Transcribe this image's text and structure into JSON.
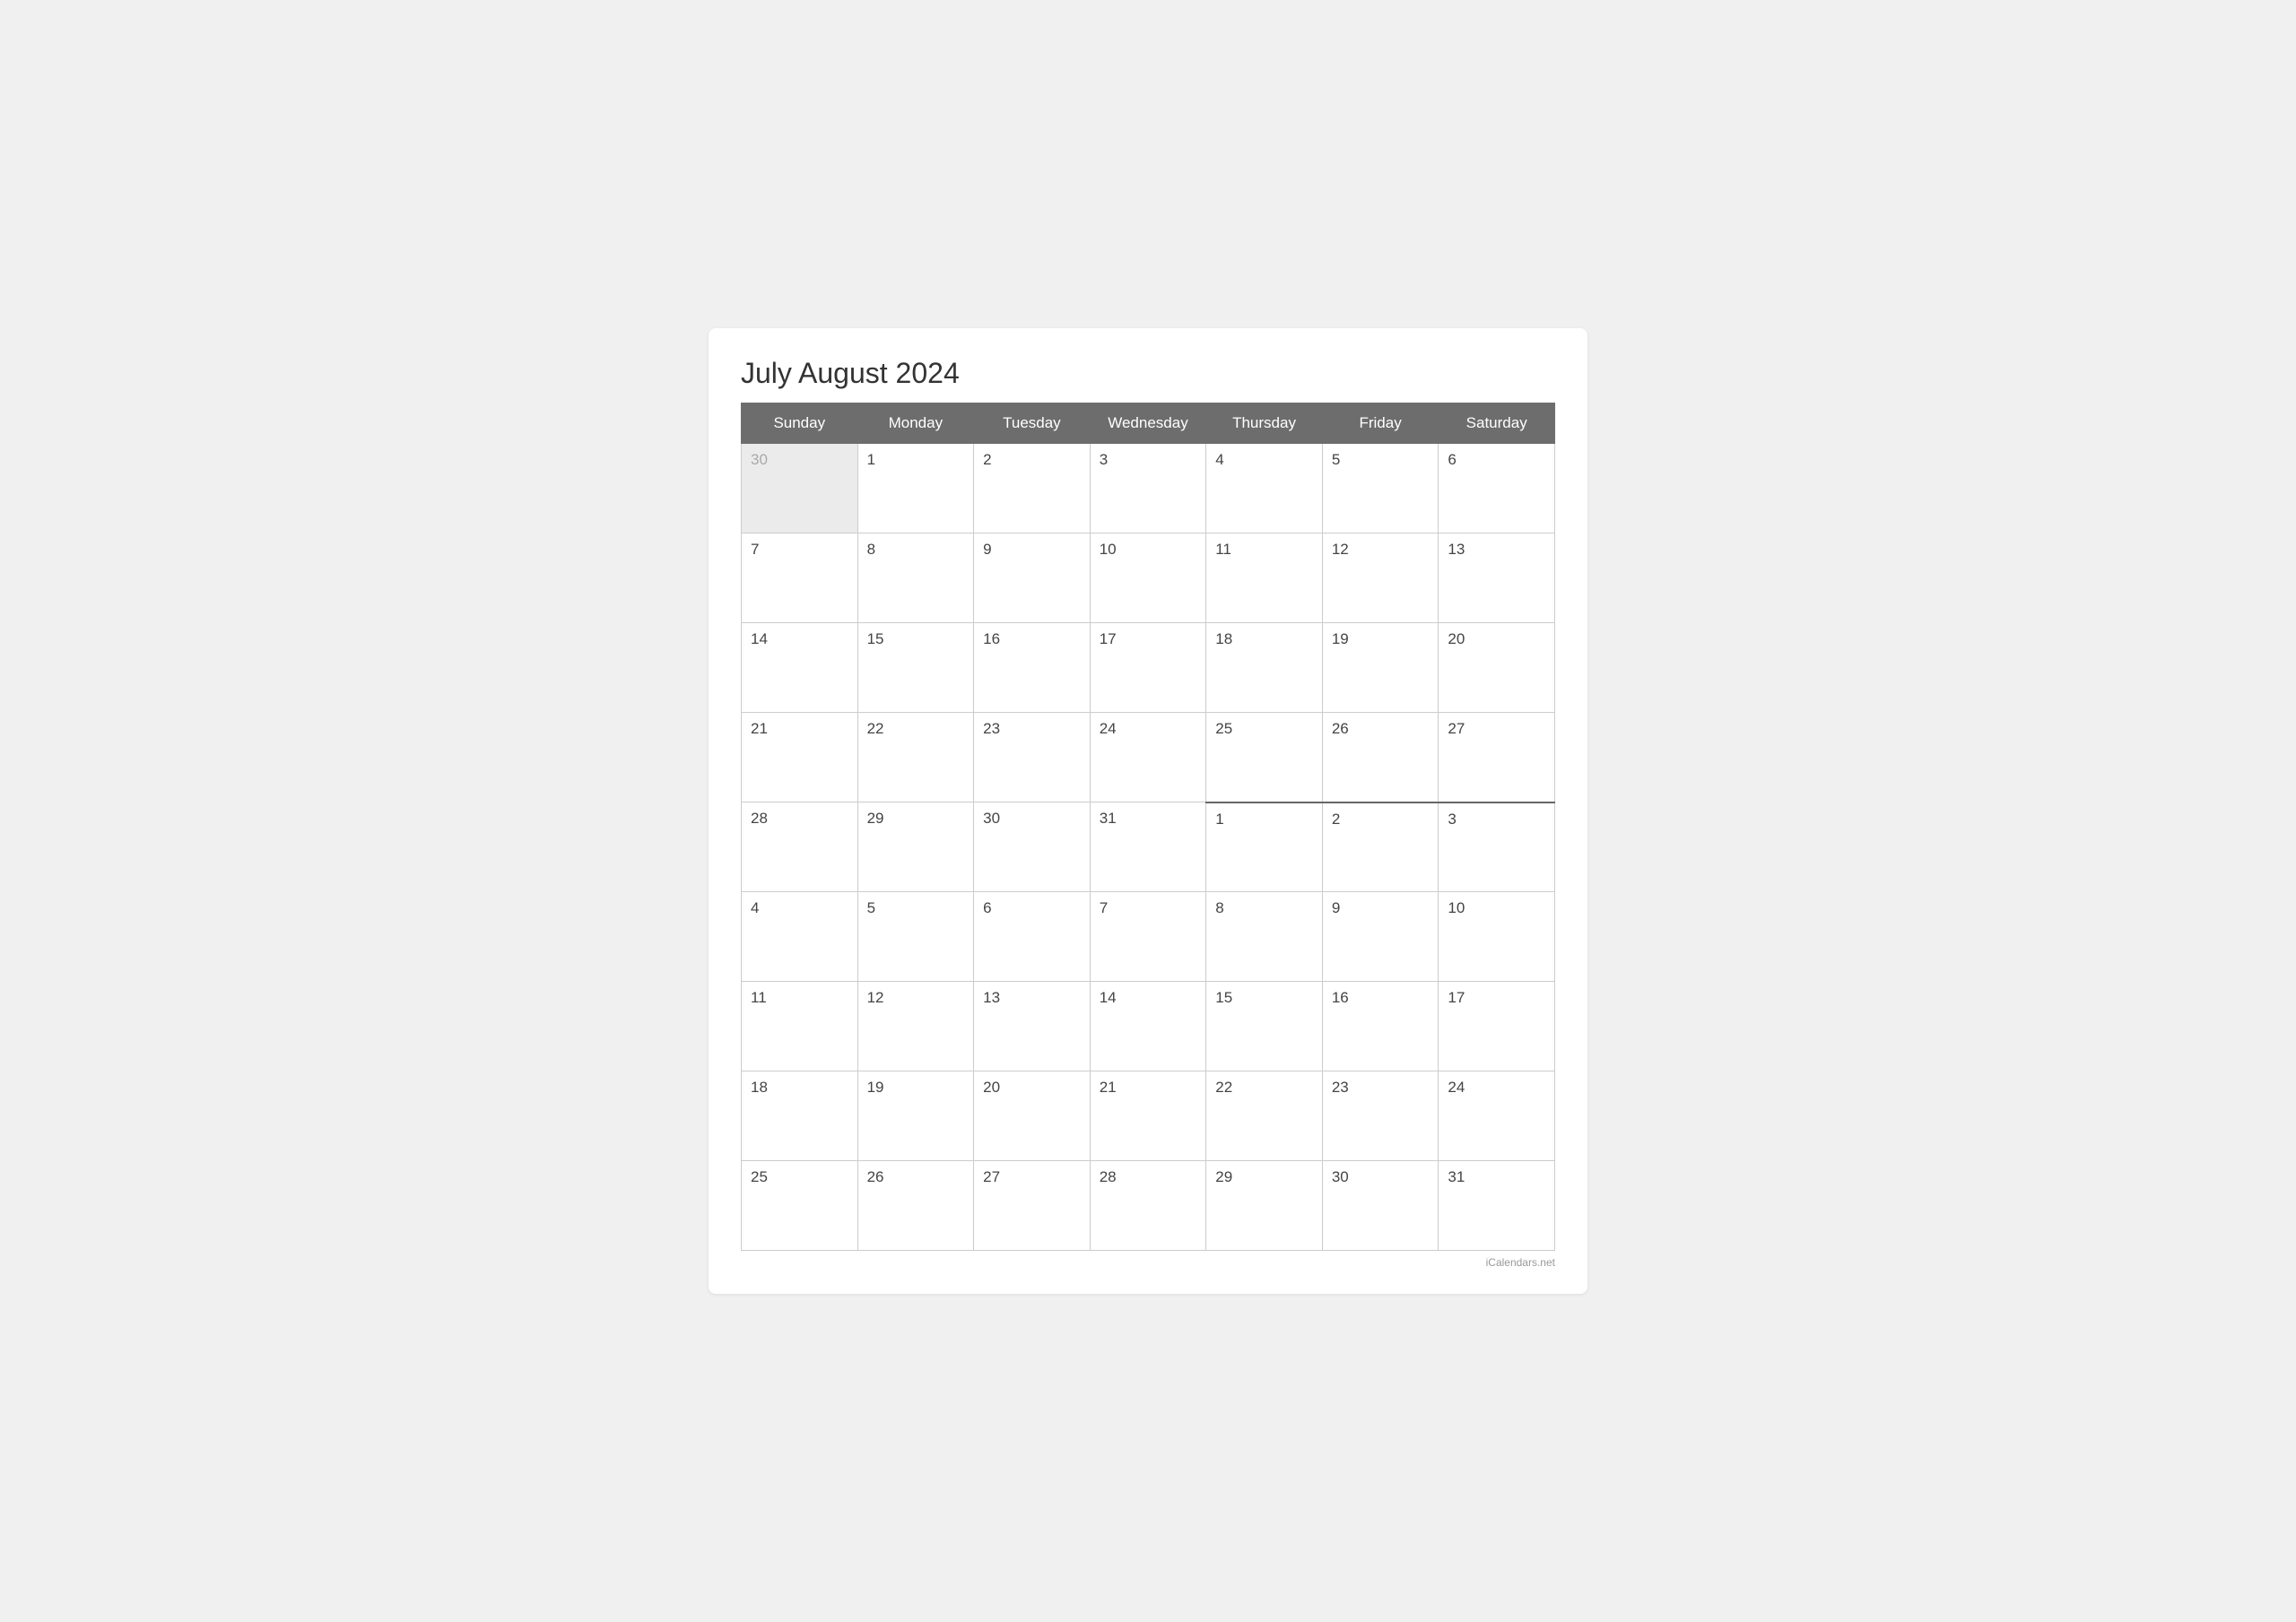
{
  "title": "July August 2024",
  "days_of_week": [
    "Sunday",
    "Monday",
    "Tuesday",
    "Wednesday",
    "Thursday",
    "Friday",
    "Saturday"
  ],
  "weeks": [
    [
      {
        "day": "30",
        "prev_month": true
      },
      {
        "day": "1"
      },
      {
        "day": "2"
      },
      {
        "day": "3"
      },
      {
        "day": "4"
      },
      {
        "day": "5"
      },
      {
        "day": "6"
      }
    ],
    [
      {
        "day": "7"
      },
      {
        "day": "8"
      },
      {
        "day": "9"
      },
      {
        "day": "10"
      },
      {
        "day": "11"
      },
      {
        "day": "12"
      },
      {
        "day": "13"
      }
    ],
    [
      {
        "day": "14"
      },
      {
        "day": "15"
      },
      {
        "day": "16"
      },
      {
        "day": "17"
      },
      {
        "day": "18"
      },
      {
        "day": "19"
      },
      {
        "day": "20"
      }
    ],
    [
      {
        "day": "21"
      },
      {
        "day": "22"
      },
      {
        "day": "23"
      },
      {
        "day": "24"
      },
      {
        "day": "25"
      },
      {
        "day": "26"
      },
      {
        "day": "27"
      }
    ],
    [
      {
        "day": "28"
      },
      {
        "day": "29"
      },
      {
        "day": "30"
      },
      {
        "day": "31"
      },
      {
        "day": "1",
        "next_month": true,
        "divider": true
      },
      {
        "day": "2",
        "next_month": true
      },
      {
        "day": "3",
        "next_month": true
      }
    ],
    [
      {
        "day": "4",
        "next_month": true
      },
      {
        "day": "5",
        "next_month": true
      },
      {
        "day": "6",
        "next_month": true
      },
      {
        "day": "7",
        "next_month": true
      },
      {
        "day": "8",
        "next_month": true
      },
      {
        "day": "9",
        "next_month": true
      },
      {
        "day": "10",
        "next_month": true
      }
    ],
    [
      {
        "day": "11",
        "next_month": true
      },
      {
        "day": "12",
        "next_month": true
      },
      {
        "day": "13",
        "next_month": true
      },
      {
        "day": "14",
        "next_month": true
      },
      {
        "day": "15",
        "next_month": true
      },
      {
        "day": "16",
        "next_month": true
      },
      {
        "day": "17",
        "next_month": true
      }
    ],
    [
      {
        "day": "18",
        "next_month": true
      },
      {
        "day": "19",
        "next_month": true
      },
      {
        "day": "20",
        "next_month": true
      },
      {
        "day": "21",
        "next_month": true
      },
      {
        "day": "22",
        "next_month": true
      },
      {
        "day": "23",
        "next_month": true
      },
      {
        "day": "24",
        "next_month": true
      }
    ],
    [
      {
        "day": "25",
        "next_month": true
      },
      {
        "day": "26",
        "next_month": true
      },
      {
        "day": "27",
        "next_month": true
      },
      {
        "day": "28",
        "next_month": true
      },
      {
        "day": "29",
        "next_month": true
      },
      {
        "day": "30",
        "next_month": true
      },
      {
        "day": "31",
        "next_month": true
      }
    ]
  ],
  "footer": "iCalendars.net"
}
